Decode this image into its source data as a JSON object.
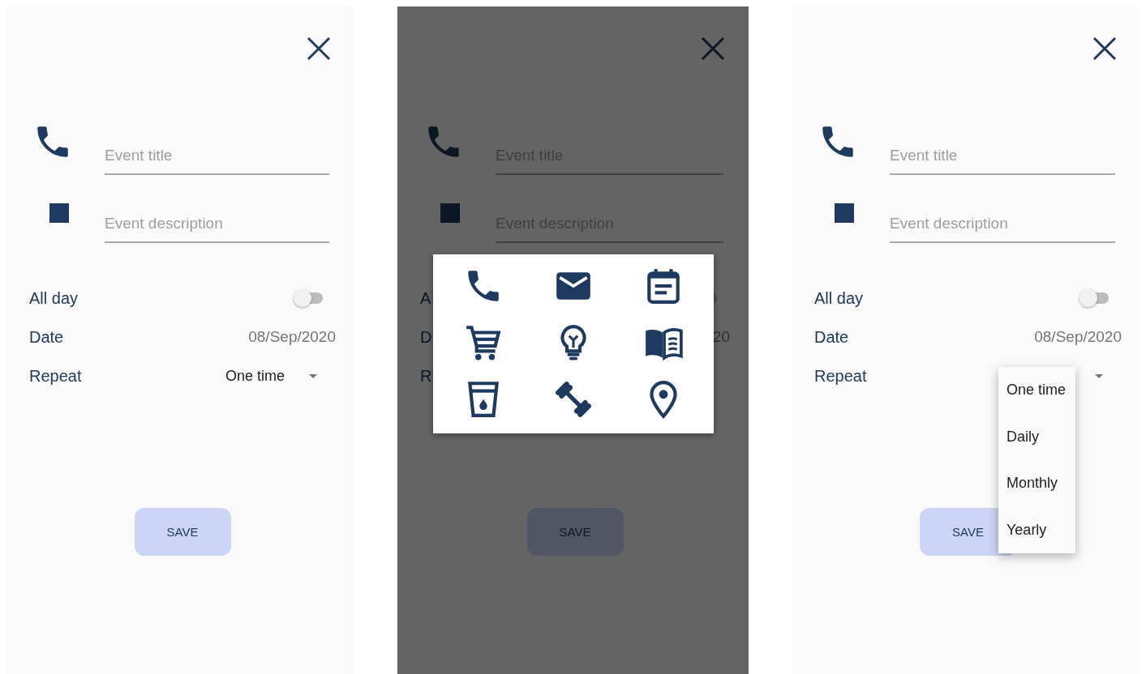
{
  "screens": [
    {
      "kind": "form",
      "fields": [
        {
          "placeholder": "Event title"
        },
        {
          "placeholder": "Event description"
        }
      ],
      "all_day": {
        "label": "All day",
        "on": false
      },
      "date": {
        "label": "Date",
        "value": "08/Sep/2020"
      },
      "repeat": {
        "label": "Repeat",
        "value": "One time"
      },
      "save_button": "SAVE"
    },
    {
      "kind": "icon_picker",
      "fields": [
        {
          "placeholder": "Event title"
        },
        {
          "placeholder": "Event description"
        }
      ],
      "all_day": {
        "label": "A",
        "on": false
      },
      "date": {
        "label": "D",
        "value": "20"
      },
      "repeat": {
        "label": "R"
      },
      "save_button": "SAVE"
    },
    {
      "kind": "repeat_menu",
      "fields": [
        {
          "placeholder": "Event title"
        },
        {
          "placeholder": "Event description"
        }
      ],
      "all_day": {
        "label": "All day",
        "on": false
      },
      "date": {
        "label": "Date",
        "value": "08/Sep/2020"
      },
      "repeat": {
        "label": "Repeat"
      },
      "save_button": "SAVE",
      "menu_options": [
        "One time",
        "Daily",
        "Monthly",
        "Yearly"
      ]
    }
  ]
}
